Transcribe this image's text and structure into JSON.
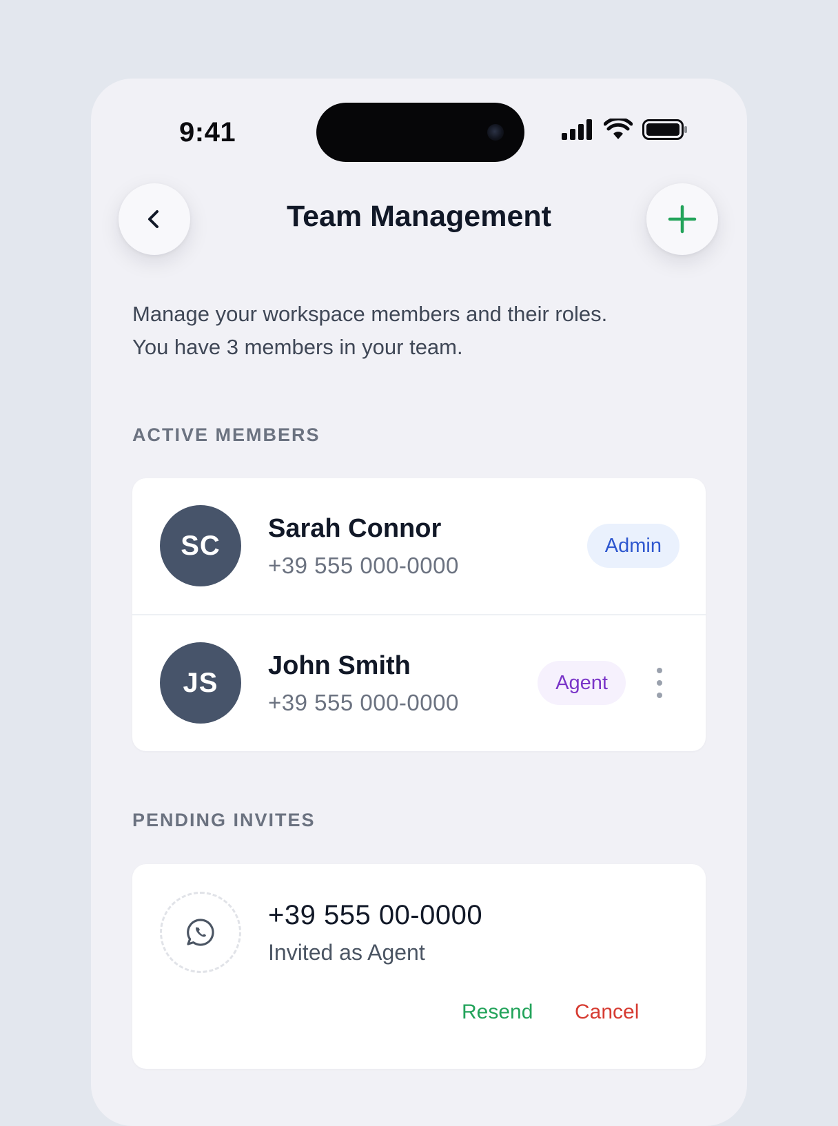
{
  "status_bar": {
    "time": "9:41"
  },
  "header": {
    "title": "Team Management",
    "back_icon": "chevron-left-icon",
    "add_icon": "plus-icon"
  },
  "description": {
    "line1": "Manage your workspace members and their roles.",
    "line2": "You have 3 members in your team."
  },
  "active_members": {
    "label": "ACTIVE MEMBERS",
    "members": [
      {
        "initials": "SC",
        "name": "Sarah Connor",
        "phone": "+39 555 000-0000",
        "role": "Admin"
      },
      {
        "initials": "JS",
        "name": "John Smith",
        "phone": "+39 555 000-0000",
        "role": "Agent"
      }
    ]
  },
  "pending_invites": {
    "label": "PENDING INVITES",
    "invites": [
      {
        "icon": "whatsapp-icon",
        "phone": "+39 555 00-0000",
        "role_text": "Invited as Agent",
        "resend_label": "Resend",
        "cancel_label": "Cancel"
      }
    ]
  },
  "colors": {
    "accent_green": "#22a35a",
    "danger_red": "#d63b31",
    "admin_blue": "#2e57cf",
    "agent_purple": "#7a35c8",
    "avatar_slate": "#47546a"
  }
}
